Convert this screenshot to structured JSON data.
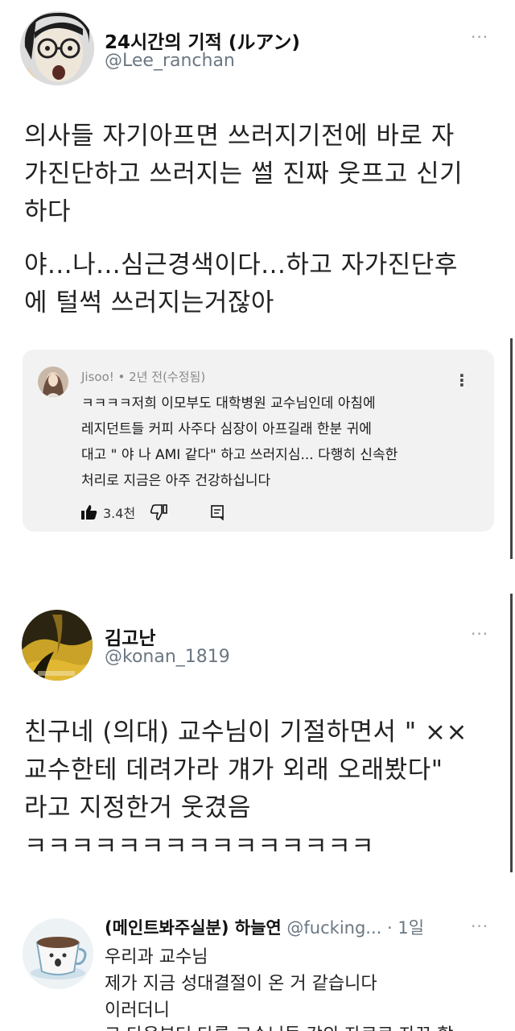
{
  "tweet1": {
    "display_name": "24시간의 기적 (ルアン)",
    "handle": "@Lee_ranchan",
    "more": "···",
    "lines": [
      "의사들 자기아프면 쓰러지기전에 바로 자",
      "가진단하고 쓰러지는 썰 진짜 웃프고 신기",
      "하다",
      "야...나...심근경색이다...하고 자가진단후",
      "에 털썩 쓰러지는거잖아"
    ]
  },
  "comment": {
    "author": "Jisoo!",
    "meta": " • 2년 전(수정됨)",
    "lines": [
      "ㅋㅋㅋㅋ저희 이모부도 대학병원 교수님인데  아침에",
      "레지던트들 커피 사주다 심장이 아프길래 한분 귀에",
      "대고 \" 야 나 AMI 같다\" 하고 쓰러지심... 다행히 신속한",
      "처리로 지금은 아주 건강하십니다"
    ],
    "likes": "3.4천",
    "menu": "⋮"
  },
  "tweet2": {
    "display_name": "김고난",
    "handle": "@konan_1819",
    "more": "···",
    "lines": [
      "친구네 (의대) 교수님이 기절하면서 \" ××",
      "교수한테 데려가라 걔가 외래 오래봤다\"",
      "라고 지정한거 웃겼음",
      "ㅋㅋㅋㅋㅋㅋㅋㅋㅋㅋㅋㅋㅋㅋㅋ"
    ]
  },
  "reply": {
    "display_name": "(메인트봐주실분) 하늘연",
    "handle_time": "@fucking... · 1일",
    "more": "···",
    "lines": [
      "우리과 교수님",
      "제가 지금 성대결절이 온 거 같습니다",
      "이러더니",
      "그 다음부터 다른 교수님들 강의 자료로 자꾸 할"
    ]
  },
  "colors": {
    "card_bg": "#f2f2f2",
    "muted": "#6b7782",
    "text": "#222222"
  }
}
